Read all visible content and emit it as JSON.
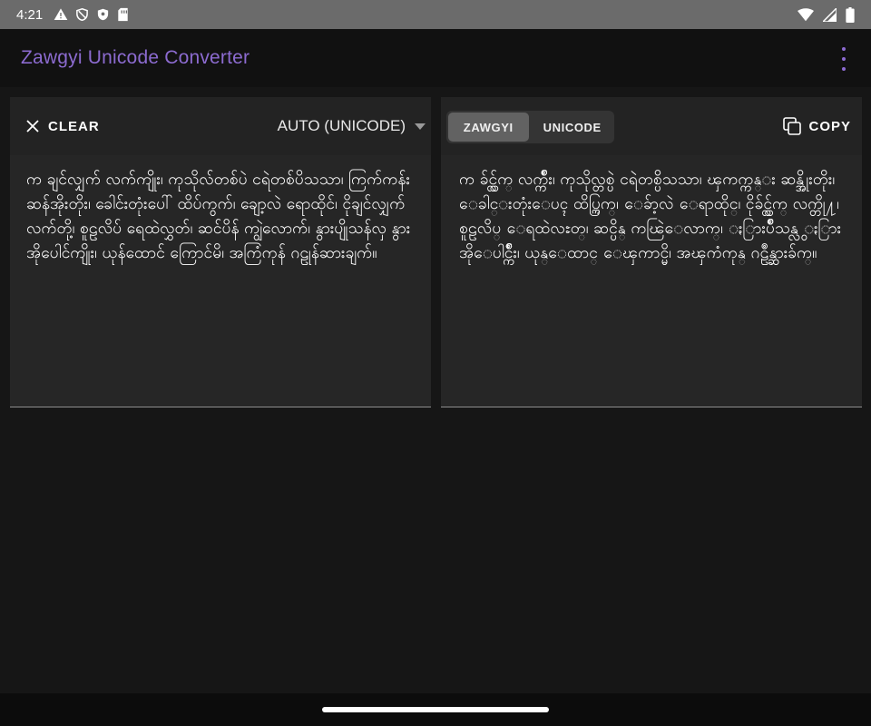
{
  "status_bar": {
    "time": "4:21",
    "icons": [
      "warning-icon",
      "shield-icon",
      "shield-check-icon",
      "sim-card-icon",
      "wifi-icon",
      "cellular-signal-icon",
      "battery-icon"
    ]
  },
  "app_bar": {
    "title": "Zawgyi Unicode Converter",
    "accent_color": "#8c6bd0"
  },
  "input_panel": {
    "clear_label": "CLEAR",
    "detect_label": "AUTO (UNICODE)",
    "text": "က ချင်လျှက် လက်ကျိုး၊ ကုသိုလ်တစ်ပဲ ငရဲတစ်ပိသသာ၊ ကြက်ကန်း ဆန်အိုးတိုး၊ ခေါင်းတုံးပေါ် ထိပ်ကွက်၊ ချော့လဲ ရောထိုင်၊ ငိုချင်လျှက် လက်တို့၊ စူဠလိပ် ရေထဲလွှတ်၊ ဆင်ပိန် ကျွဲလောက်၊ နွားပျိုသန်လှ နွားအိုပေါင်ကျိုး၊ ယုန်ထောင် ကြောင်မိ၊ အကြံကုန် ဂဠုန်ဆားချက်။"
  },
  "output_panel": {
    "tabs": [
      {
        "label": "ZAWGYI",
        "active": true
      },
      {
        "label": "UNICODE",
        "active": false
      }
    ],
    "copy_label": "COPY",
    "text": " က ခ်င္လ်ွက္ လက္က်ိဳး၊ ကုသိုလ္တစ္ပဲ ငရဲတစ္ပိသသာ၊ ၾကက္ကန္း ဆန္အိုးတိုး၊ ေခါင္းတုံးေပၚ ထိပ္ကြက္၊ ေခ်ာ့လဲ ေရာထိုင္၊ ငိုခ်င္လ်ွက္ လက္တို႔၊ စူဠလိပ္ ေရထဲလႊတ္၊ ဆင္ပိန္ ကၽြဲေလာက္၊ ႏြားပ်ိဳသန္လွ ႏြားအိုေပါင္က်ိဳး၊ ယုန္ေထာင္ ေၾကာင္မိ၊ အၾကံကုန္ ဂဠဳန္ဆားခ်က္။"
  }
}
